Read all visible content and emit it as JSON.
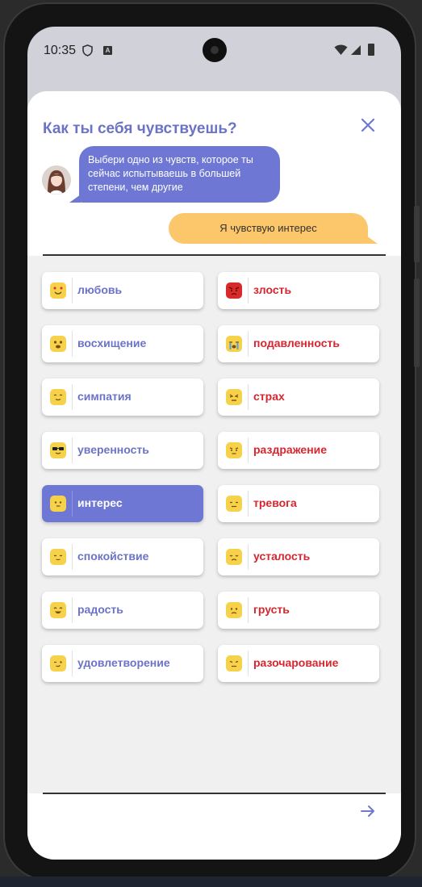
{
  "status_bar": {
    "time": "10:35",
    "a_badge": "A"
  },
  "dialog": {
    "title": "Как ты себя чувствуешь?",
    "bot_message": "Выбери одно из чувств, которое ты сейчас испытываешь в большей степени, чем другие",
    "user_message": "Я чувствую интерес"
  },
  "emotions_left": [
    {
      "label": "любовь",
      "icon": "heart-eyes-emoji"
    },
    {
      "label": "восхищение",
      "icon": "star-struck-emoji"
    },
    {
      "label": "симпатия",
      "icon": "smiling-emoji"
    },
    {
      "label": "уверенность",
      "icon": "sunglasses-emoji"
    },
    {
      "label": "интерес",
      "icon": "curious-emoji",
      "selected": true
    },
    {
      "label": "спокойствие",
      "icon": "calm-emoji"
    },
    {
      "label": "радость",
      "icon": "grinning-emoji"
    },
    {
      "label": "удовлетворение",
      "icon": "winking-emoji"
    }
  ],
  "emotions_right": [
    {
      "label": "злость",
      "icon": "angry-emoji"
    },
    {
      "label": "подавленность",
      "icon": "crying-emoji"
    },
    {
      "label": "страх",
      "icon": "scared-emoji"
    },
    {
      "label": "раздражение",
      "icon": "annoyed-emoji"
    },
    {
      "label": "тревога",
      "icon": "anxious-emoji"
    },
    {
      "label": "усталость",
      "icon": "tired-emoji"
    },
    {
      "label": "грусть",
      "icon": "sad-emoji"
    },
    {
      "label": "разочарование",
      "icon": "disappointed-emoji"
    }
  ],
  "colors": {
    "accent": "#6e77d3",
    "positive_text": "#6b73c7",
    "negative_text": "#d6262f",
    "user_bubble": "#fcc66a",
    "emoji_yellow": "#f6d24b"
  }
}
